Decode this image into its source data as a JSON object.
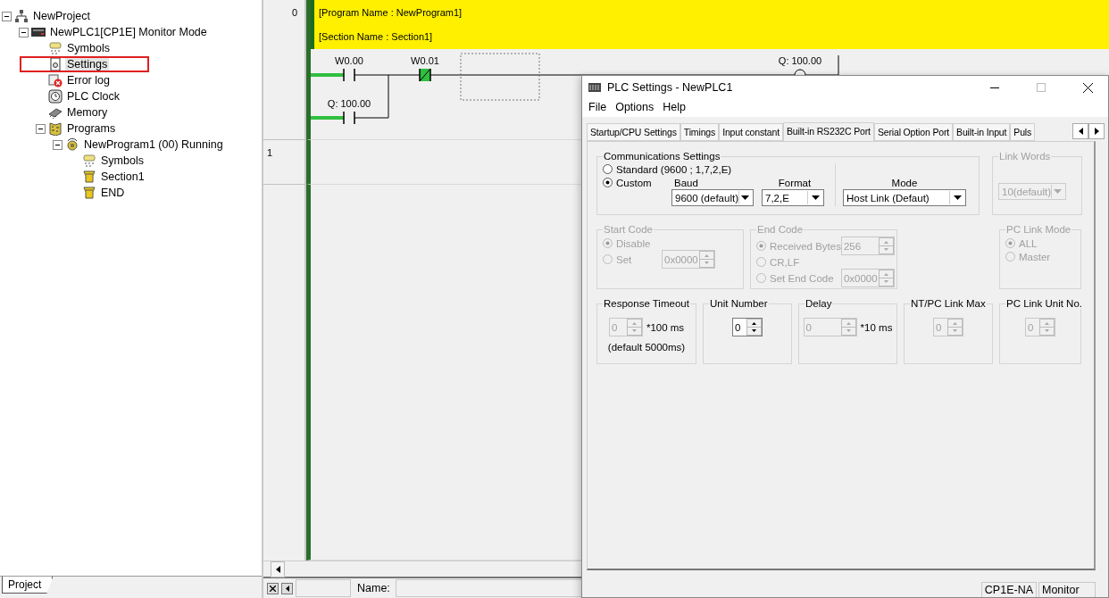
{
  "project_tree": {
    "label": "NewProject",
    "kind": "project",
    "selected": false,
    "marked": false,
    "expanded": true,
    "children": [
      {
        "label": "NewPLC1[CP1E] Monitor Mode",
        "kind": "plc",
        "selected": false,
        "marked": false,
        "expanded": true,
        "children": [
          {
            "label": "Symbols",
            "kind": "symbols",
            "selected": false,
            "marked": false
          },
          {
            "label": "Settings",
            "kind": "settings",
            "selected": true,
            "marked": true
          },
          {
            "label": "Error log",
            "kind": "error",
            "selected": false,
            "marked": false
          },
          {
            "label": "PLC Clock",
            "kind": "clock",
            "selected": false,
            "marked": false
          },
          {
            "label": "Memory",
            "kind": "memory",
            "selected": false,
            "marked": false
          },
          {
            "label": "Programs",
            "kind": "programs",
            "selected": false,
            "marked": false,
            "expanded": true,
            "children": [
              {
                "label": "NewProgram1 (00) Running",
                "kind": "program",
                "selected": false,
                "marked": false,
                "expanded": true,
                "children": [
                  {
                    "label": "Symbols",
                    "kind": "symbols",
                    "selected": false,
                    "marked": false
                  },
                  {
                    "label": "Section1",
                    "kind": "section",
                    "selected": false,
                    "marked": false
                  },
                  {
                    "label": "END",
                    "kind": "section",
                    "selected": false,
                    "marked": false
                  }
                ]
              }
            ]
          }
        ]
      }
    ]
  },
  "project_tab": "Project",
  "ladder": {
    "rungs": [
      {
        "number": "0",
        "comments": [
          "[Program Name : NewProgram1]",
          "[Section Name : Section1]"
        ],
        "contacts": [
          {
            "label": "W0.00",
            "kind": "no",
            "on": true
          },
          {
            "label": "W0.01",
            "kind": "nc",
            "on": true
          },
          {
            "label": "Q: 100.00",
            "kind": "no",
            "on": true
          }
        ],
        "coil": {
          "label": "Q: 100.00"
        }
      },
      {
        "number": "1"
      }
    ]
  },
  "bottom_bar": {
    "name_label": "Name:"
  },
  "dialog": {
    "title": "PLC Settings - NewPLC1",
    "menu": [
      "File",
      "Options",
      "Help"
    ],
    "tabs": [
      {
        "label": "Startup/CPU Settings",
        "selected": false
      },
      {
        "label": "Timings",
        "selected": false
      },
      {
        "label": "Input constant",
        "selected": false
      },
      {
        "label": "Built-in RS232C Port",
        "selected": true
      },
      {
        "label": "Serial Option Port",
        "selected": false
      },
      {
        "label": "Built-in Input",
        "selected": false
      },
      {
        "label": "Puls",
        "selected": false
      }
    ],
    "communications": {
      "title": "Communications Settings",
      "options": [
        {
          "label": "Standard (9600 ; 1,7,2,E)",
          "checked": false
        },
        {
          "label": "Custom",
          "checked": true
        }
      ],
      "baud": {
        "label": "Baud",
        "value": "9600 (default)"
      },
      "format": {
        "label": "Format",
        "value": "7,2,E"
      },
      "mode": {
        "label": "Mode",
        "value": "Host Link (Defaut)"
      }
    },
    "link_words": {
      "title": "Link Words",
      "value": "10(default)",
      "disabled": true
    },
    "start_code": {
      "title": "Start Code",
      "disabled": true,
      "options": [
        {
          "label": "Disable",
          "checked": true
        },
        {
          "label": "Set",
          "checked": false
        }
      ],
      "value": "0x0000"
    },
    "end_code": {
      "title": "End Code",
      "disabled": true,
      "options": [
        {
          "label": "Received Bytes",
          "checked": true,
          "value": "256"
        },
        {
          "label": "CR,LF",
          "checked": false
        },
        {
          "label": "Set End Code",
          "checked": false,
          "value": "0x0000"
        }
      ]
    },
    "pc_link_mode": {
      "title": "PC Link Mode",
      "disabled": true,
      "options": [
        {
          "label": "ALL",
          "checked": true
        },
        {
          "label": "Master",
          "checked": false
        }
      ]
    },
    "numeric_groups": [
      {
        "title": "Response Timeout",
        "value": "0",
        "unit": "*100 ms",
        "note": "(default 5000ms)",
        "disabled": true
      },
      {
        "title": "Unit Number",
        "value": "0",
        "disabled": false
      },
      {
        "title": "Delay",
        "value": "0",
        "unit": "*10 ms",
        "disabled": true
      },
      {
        "title": "NT/PC Link Max",
        "value": "0",
        "disabled": true
      },
      {
        "title": "PC Link Unit No.",
        "value": "0",
        "disabled": true
      }
    ],
    "status": [
      "CP1E-NA",
      "Monitor"
    ]
  }
}
